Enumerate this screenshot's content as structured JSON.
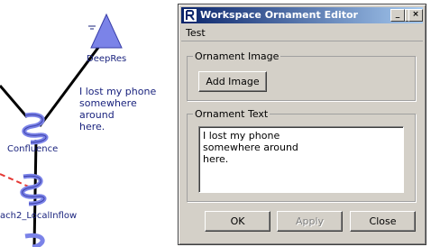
{
  "canvas": {
    "nodes": [
      {
        "label": "DeepRes"
      },
      {
        "label": "Confluence"
      },
      {
        "label": "ach2_LocalInflow"
      }
    ],
    "ornament_lines": [
      "I lost my phone",
      "somewhere around",
      "here."
    ]
  },
  "dialog": {
    "title": "Workspace Ornament Editor",
    "menu": [
      "Test"
    ],
    "image_group": {
      "legend": "Ornament Image",
      "add_button": "Add Image"
    },
    "text_group": {
      "legend": "Ornament Text",
      "lines": [
        "I lost my phone",
        "somewhere around",
        "here."
      ]
    },
    "buttons": {
      "ok": "OK",
      "apply": "Apply",
      "close": "Close"
    },
    "apply_enabled": false,
    "titlebar_buttons": {
      "minimize": "_",
      "maximize": "□",
      "close": "×"
    }
  },
  "colors": {
    "node_fill": "#7b83e8",
    "node_label": "#1a237e",
    "titlebar_start": "#0a246a",
    "titlebar_end": "#a6caf0",
    "dialog_bg": "#d4d0c8",
    "dashed_link": "#e53935"
  },
  "icons": [
    "triangle-reservoir-icon",
    "spiral-confluence-icon",
    "app-icon",
    "minimize-icon",
    "maximize-icon",
    "close-icon"
  ]
}
